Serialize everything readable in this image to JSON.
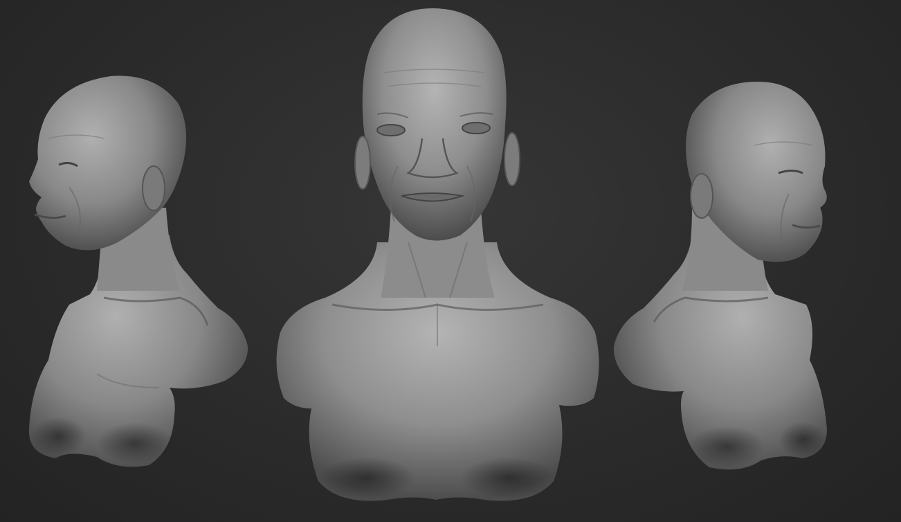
{
  "scene": {
    "background_color": "#2c2c2c",
    "material_color": "#8f8f8f",
    "views": [
      {
        "name": "left-three-quarter",
        "facing": "left"
      },
      {
        "name": "front",
        "facing": "front"
      },
      {
        "name": "right-three-quarter",
        "facing": "right"
      }
    ]
  }
}
